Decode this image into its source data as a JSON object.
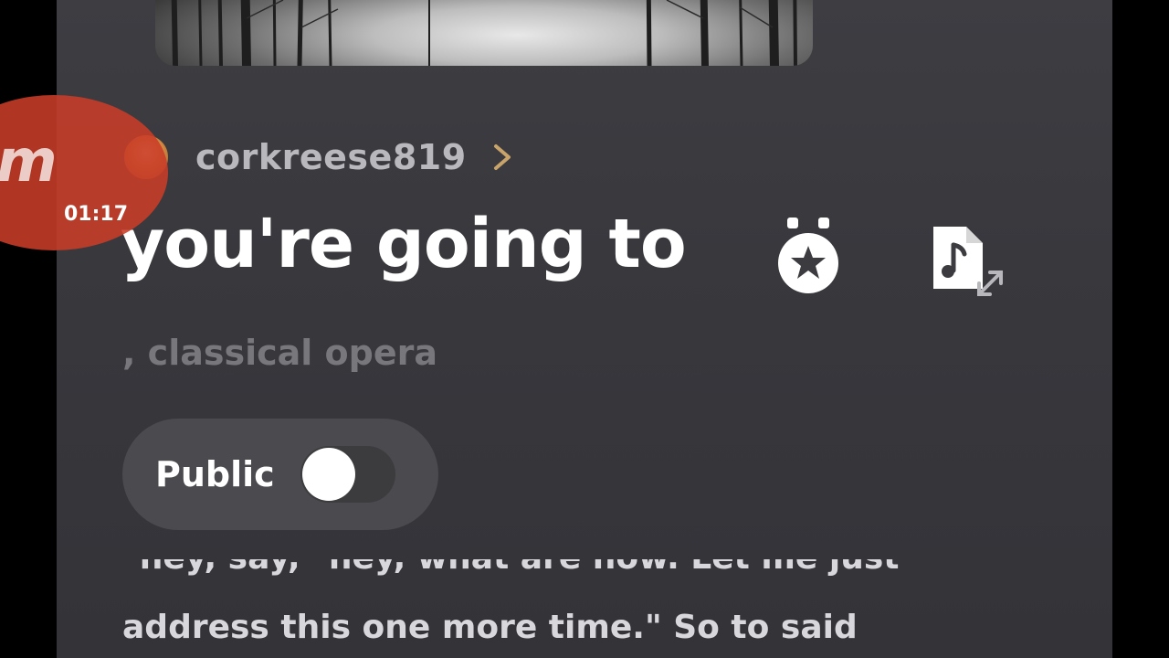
{
  "creator": {
    "username": "corkreese819",
    "avatar_icon": "user-avatar",
    "chevron_icon": "chevron-right-icon"
  },
  "song": {
    "title": "you're going to",
    "tags": ", classical opera",
    "badge_icon": "award-medal-icon",
    "lyrics_icon": "music-file-expand-icon"
  },
  "visibility": {
    "label": "Public",
    "toggle_on": false
  },
  "description": {
    "line_cut": "\"hey, say, \"hey, what are now. Let me just",
    "line": "address this one more time.\" So to said"
  },
  "recording_overlay": {
    "logo": "m",
    "timer": "01:17"
  },
  "colors": {
    "panel_bg": "#3b3b40",
    "accent": "#c9a46a",
    "recorder": "#c83c28"
  }
}
